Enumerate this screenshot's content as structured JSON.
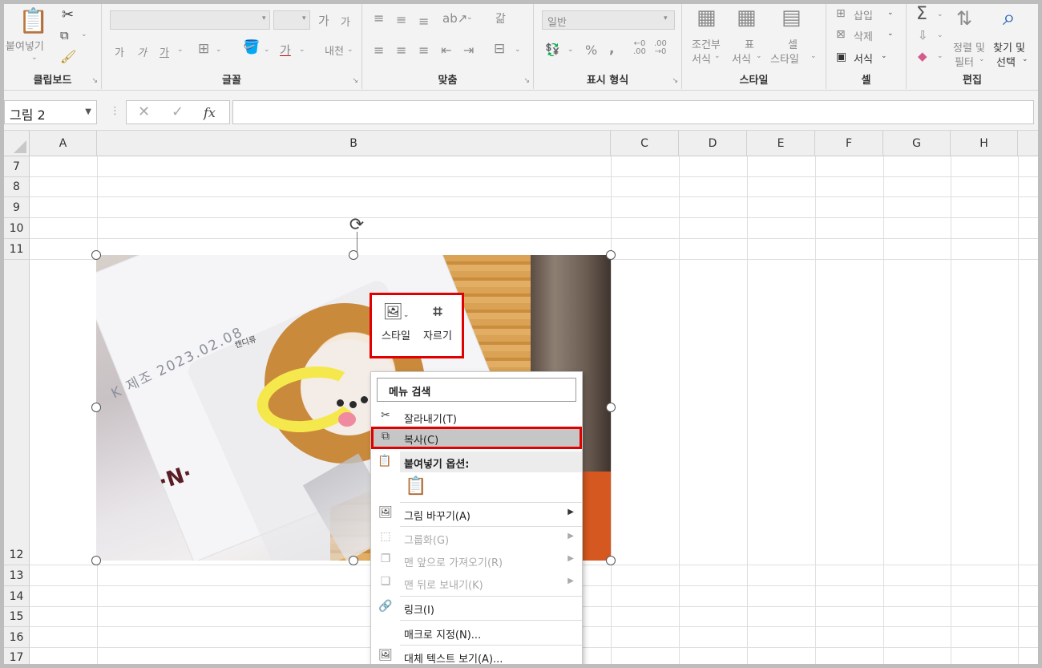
{
  "ribbon": {
    "clipboard": {
      "paste": "붙여넣기",
      "label": "클립보드"
    },
    "font": {
      "label": "글꼴",
      "font_name": "",
      "font_size": "",
      "grow": "가",
      "shrink": "가",
      "bold": "가",
      "italic": "가",
      "underline": "가",
      "font_color": "가",
      "phonetic": "내천"
    },
    "alignment": {
      "label": "맞춤",
      "orientation": "가",
      "wrap": "갊"
    },
    "number": {
      "label": "표시 형식",
      "format": "일반",
      "percent": "%",
      "comma": ",",
      "inc_dec": "←0\n.00",
      "dec_dec": ".00\n→0"
    },
    "styles": {
      "label": "스타일",
      "conditional": [
        "조건부",
        "서식"
      ],
      "table": [
        "표",
        "서식"
      ],
      "cell": [
        "셀",
        "스타일"
      ]
    },
    "cells": {
      "label": "셀",
      "insert": "삽입",
      "delete": "삭제",
      "format": "서식"
    },
    "editing": {
      "label": "편집",
      "sigma": "Σ",
      "sort": [
        "정렬 및",
        "필터"
      ],
      "find": [
        "찾기 및",
        "선택"
      ]
    }
  },
  "formula_bar": {
    "name_box": "그림 2",
    "cancel": "✕",
    "enter": "✓",
    "fx": "fx",
    "value": ""
  },
  "columns": [
    "A",
    "B",
    "C",
    "D",
    "E",
    "F",
    "G",
    "H"
  ],
  "rows": [
    "7",
    "8",
    "9",
    "10",
    "11",
    "12",
    "13",
    "14",
    "15",
    "16",
    "17"
  ],
  "picture": {
    "stamp_text": "K 제조 2023.02.08",
    "logo_text": "·N·",
    "label_text": "캔디류"
  },
  "mini_toolbar": {
    "style_label": "스타일",
    "crop_label": "자르기"
  },
  "context_menu": {
    "search": "메뉴 검색",
    "items": [
      {
        "label": "잘라내기(T)",
        "icon": "scissors-icon"
      },
      {
        "label": "복사(C)",
        "icon": "copy-icon"
      },
      {
        "label": "붙여넣기 옵션:",
        "icon": "paste-icon"
      },
      {
        "label": "그림 바꾸기(A)",
        "icon": "change-picture-icon",
        "arrow": "▶"
      },
      {
        "label": "그룹화(G)",
        "icon": "group-icon",
        "arrow": "▶"
      },
      {
        "label": "맨 앞으로 가져오기(R)",
        "icon": "bring-forward-icon",
        "arrow": "▶"
      },
      {
        "label": "맨 뒤로 보내기(K)",
        "icon": "send-backward-icon",
        "arrow": "▶"
      },
      {
        "label": "링크(I)",
        "icon": "link-icon"
      },
      {
        "label": "매크로 지정(N)...",
        "icon": ""
      },
      {
        "label": "대체 텍스트 보기(A)...",
        "icon": "alt-text-icon"
      }
    ]
  },
  "colors": {
    "highlight_border": "#e00000",
    "menu_highlight": "#c6c6c6"
  }
}
